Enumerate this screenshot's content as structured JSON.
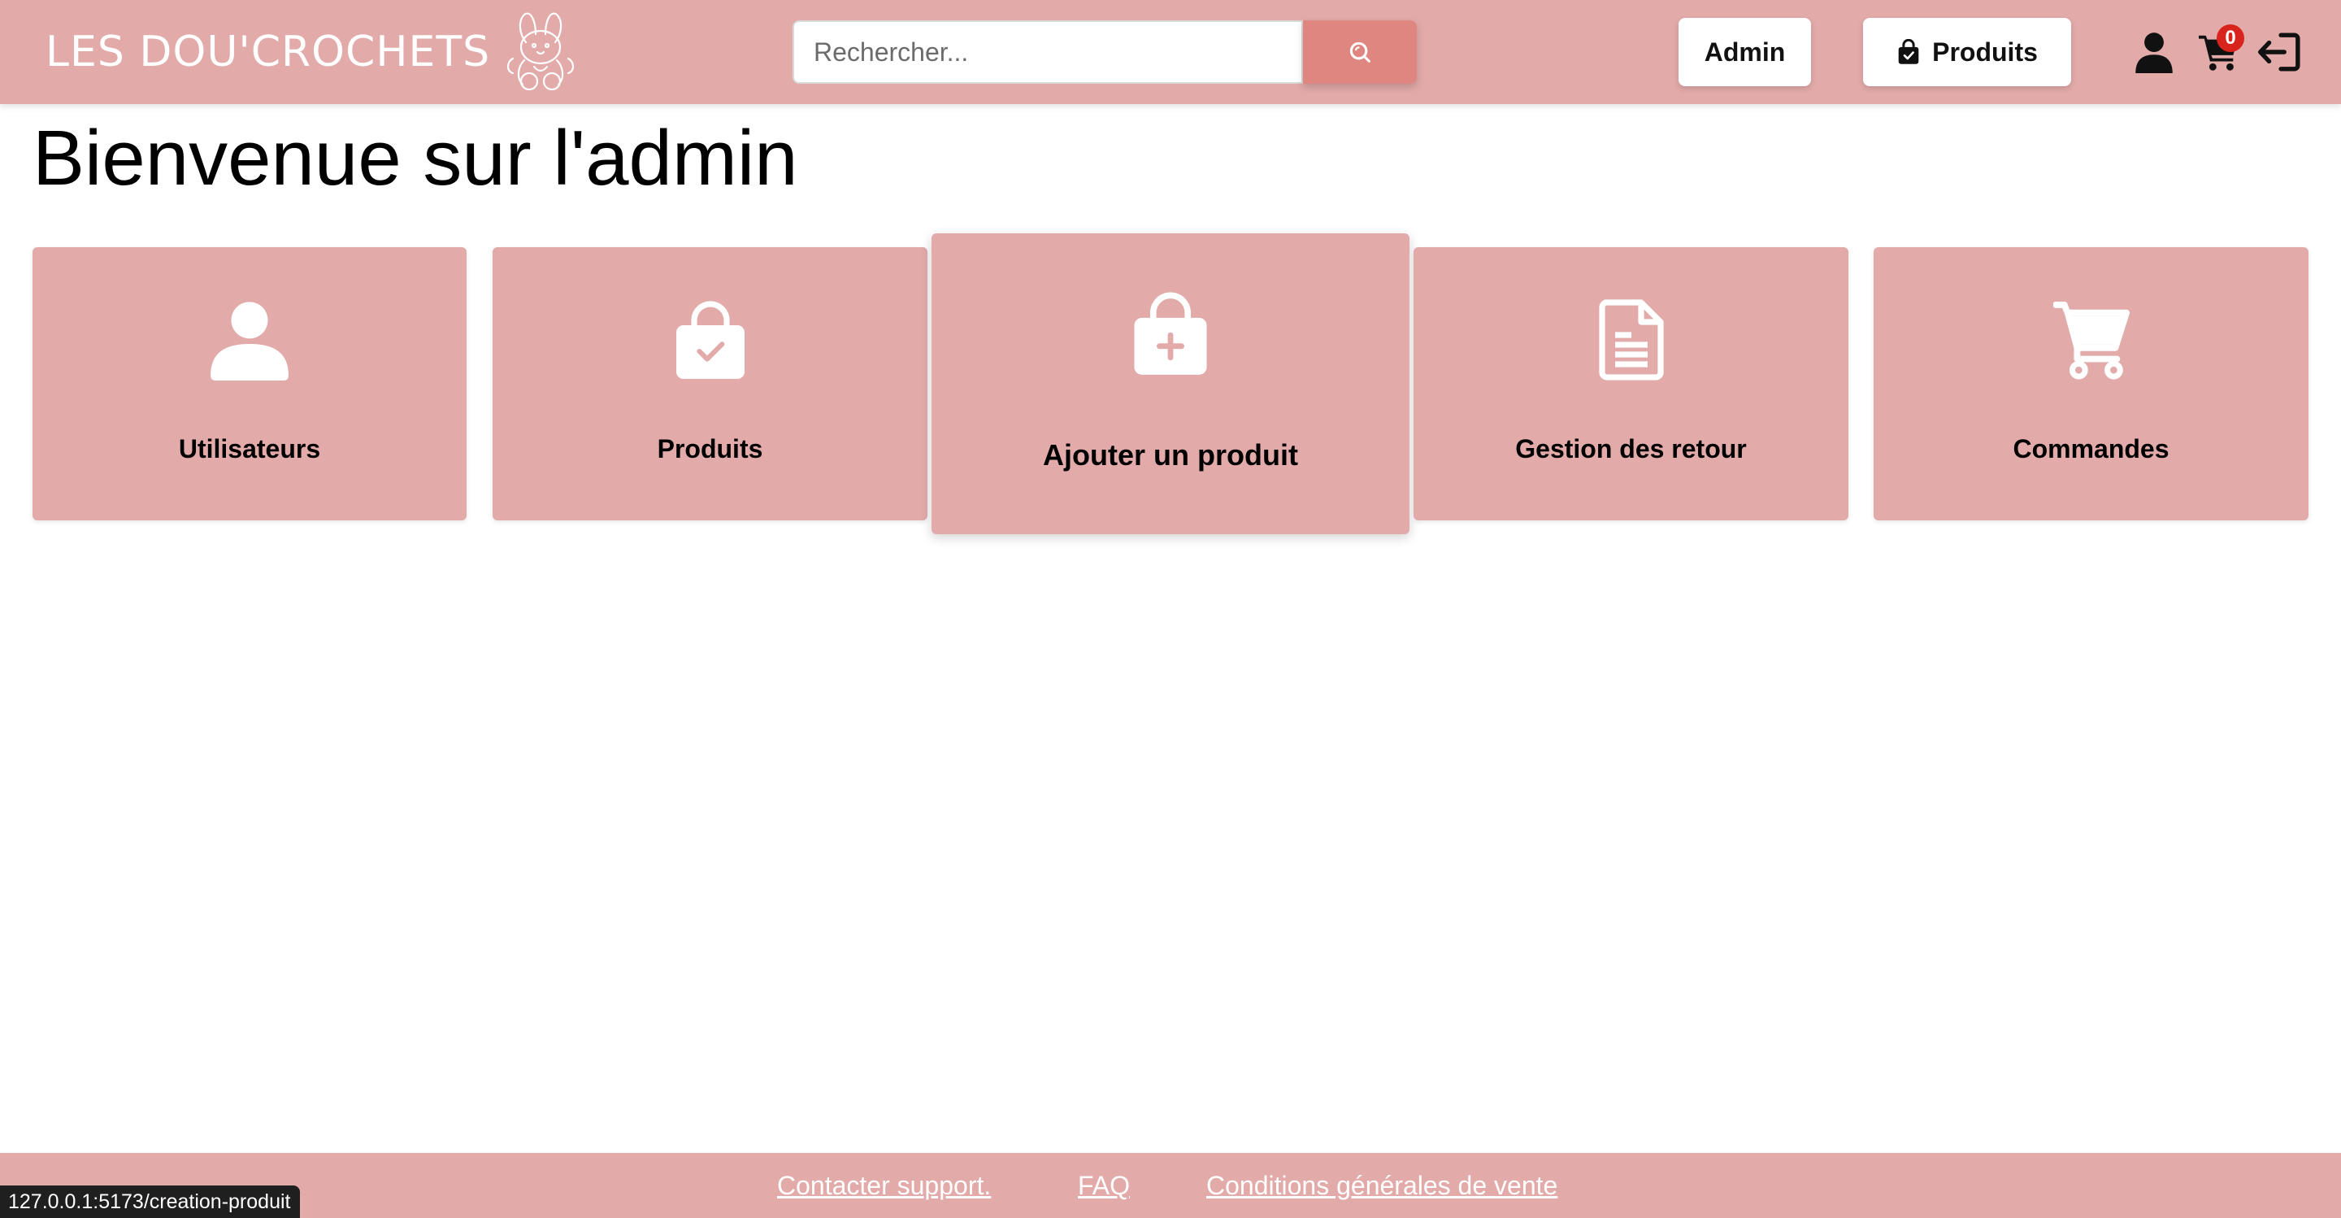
{
  "header": {
    "logo_text": "LES DOU'CROCHETS",
    "search": {
      "placeholder": "Rechercher...",
      "value": ""
    },
    "admin_label": "Admin",
    "produits_label": "Produits",
    "cart_count": "0",
    "icons": [
      "bunny-logo-icon",
      "search-icon",
      "shopping-bag-icon",
      "user-icon",
      "cart-icon",
      "logout-icon"
    ]
  },
  "main": {
    "title": "Bienvenue sur l'admin",
    "cards": [
      {
        "label": "Utilisateurs",
        "icon": "user-icon"
      },
      {
        "label": "Produits",
        "icon": "bag-check-icon"
      },
      {
        "label": "Ajouter un produit",
        "icon": "bag-plus-icon"
      },
      {
        "label": "Gestion des retour",
        "icon": "document-icon"
      },
      {
        "label": "Commandes",
        "icon": "cart-icon"
      }
    ]
  },
  "footer": {
    "links": [
      {
        "label": "Contacter support."
      },
      {
        "label": "FAQ"
      },
      {
        "label": "Conditions générales de vente"
      }
    ]
  },
  "status_bar": {
    "url": "127.0.0.1:5173/creation-produit"
  },
  "colors": {
    "brand_pink": "#e2aaa9",
    "search_button": "#df8680",
    "badge_red": "#d9231d"
  }
}
